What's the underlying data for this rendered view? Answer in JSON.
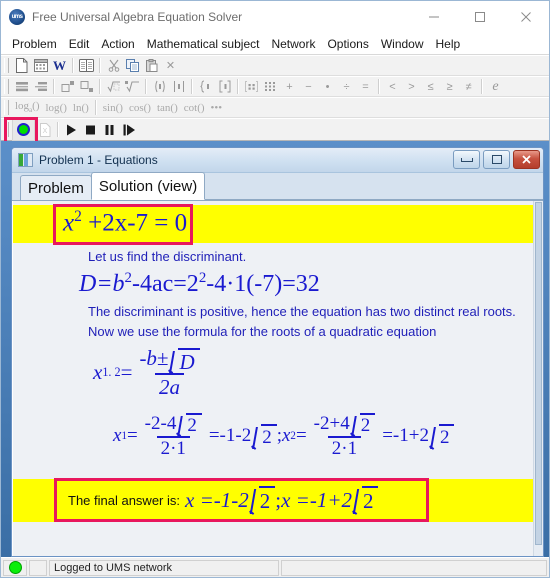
{
  "window": {
    "title": "Free Universal Algebra Equation Solver",
    "logo_text": "ums",
    "controls": {
      "minimize": "minimize-button",
      "maximize": "maximize-button",
      "close": "close-button"
    }
  },
  "menu": {
    "items": [
      "Problem",
      "Edit",
      "Action",
      "Mathematical subject",
      "Network",
      "Options",
      "Window",
      "Help"
    ]
  },
  "toolbar_file": {
    "buttons": [
      {
        "name": "new-document-icon",
        "glyph": ""
      },
      {
        "name": "new-table-icon",
        "glyph": ""
      },
      {
        "name": "word-export-icon",
        "glyph": "W"
      },
      {
        "name": "book-icon",
        "glyph": ""
      },
      {
        "name": "cut-icon",
        "glyph": ""
      },
      {
        "name": "copy-icon",
        "glyph": ""
      },
      {
        "name": "paste-icon",
        "glyph": ""
      },
      {
        "name": "delete-icon",
        "glyph": "✕"
      }
    ]
  },
  "toolbar_math": {
    "buttons": [
      "fraction-icon",
      "fraction-stacked-icon",
      "superscript-icon",
      "subscript-icon",
      "square-root-icon",
      "nth-root-icon",
      "parentheses-icon",
      "abs-bars-icon",
      "brace-icon",
      "bracket-icon",
      "matrix-2x2-icon",
      "matrix-3x3-icon"
    ],
    "operators": [
      "+",
      "−",
      "•",
      "÷",
      "="
    ],
    "relations": [
      "<",
      ">",
      "≤",
      "≥",
      "≠"
    ],
    "constant": "e"
  },
  "toolbar_functions": {
    "log_items": [
      "log",
      "log",
      "ln"
    ],
    "log_subs": [
      "a",
      "",
      ""
    ],
    "trig_items": [
      "sin",
      "cos",
      "tan",
      "cot"
    ],
    "more": "•••"
  },
  "playbar": {
    "status_indicator": "green-status-circle",
    "buttons": [
      "excel-export-icon",
      "play-button",
      "stop-button",
      "pause-button",
      "step-button"
    ],
    "highlight_color": "#e8175d"
  },
  "child_window": {
    "title": "Problem 1 - Equations",
    "tabs": [
      {
        "label": "Problem",
        "active": false
      },
      {
        "label": "Solution (view)",
        "active": true
      }
    ],
    "controls": {
      "minimize": "minimize-button",
      "restore": "restore-button",
      "close": "close-button"
    }
  },
  "solution": {
    "highlight_box_color": "#e8175d",
    "highlight_row_color": "#ffff00",
    "text_color": "#1f1fb8",
    "equation": {
      "base": "x",
      "exponent": "2",
      "rest": "+2x-7 = 0"
    },
    "line_discriminant_intro": "Let us find the discriminant.",
    "discriminant": {
      "lhs": "D=b",
      "exp1": "2",
      "mid": "-4ac=2",
      "exp2": "2",
      "tail": "-4·1(-7)=32"
    },
    "line_positive": "The discriminant is positive, hence the equation has two distinct real roots.",
    "line_formula_intro": "Now we use  the formula for the roots of a quadratic equation",
    "formula": {
      "lhs_var": "x",
      "lhs_sub": "1. 2",
      "eq": "=",
      "numerator_pre": "-b±",
      "numerator_root": "D",
      "denominator": "2a"
    },
    "roots": {
      "x1_var": "x",
      "x1_sub": "1",
      "x1_eq": "=",
      "x1_num_pre": "-2-4",
      "x1_num_root": "2",
      "x1_den": "2·1",
      "x1_result_pre": "=-1-2",
      "x1_result_root": "2",
      "separator": ";",
      "x2_var": "x",
      "x2_sub": "2",
      "x2_eq": "=",
      "x2_num_pre": "-2+4",
      "x2_num_root": "2",
      "x2_den": "2·1",
      "x2_result_pre": "=-1+2",
      "x2_result_root": "2"
    },
    "final": {
      "label": "The final answer is:",
      "a_pre": "x =-1-2",
      "a_root": "2",
      "sep": ";",
      "b_pre": "x =-1+2",
      "b_root": "2"
    }
  },
  "statusbar": {
    "indicator": "green-network-circle",
    "message": "Logged to UMS network"
  }
}
